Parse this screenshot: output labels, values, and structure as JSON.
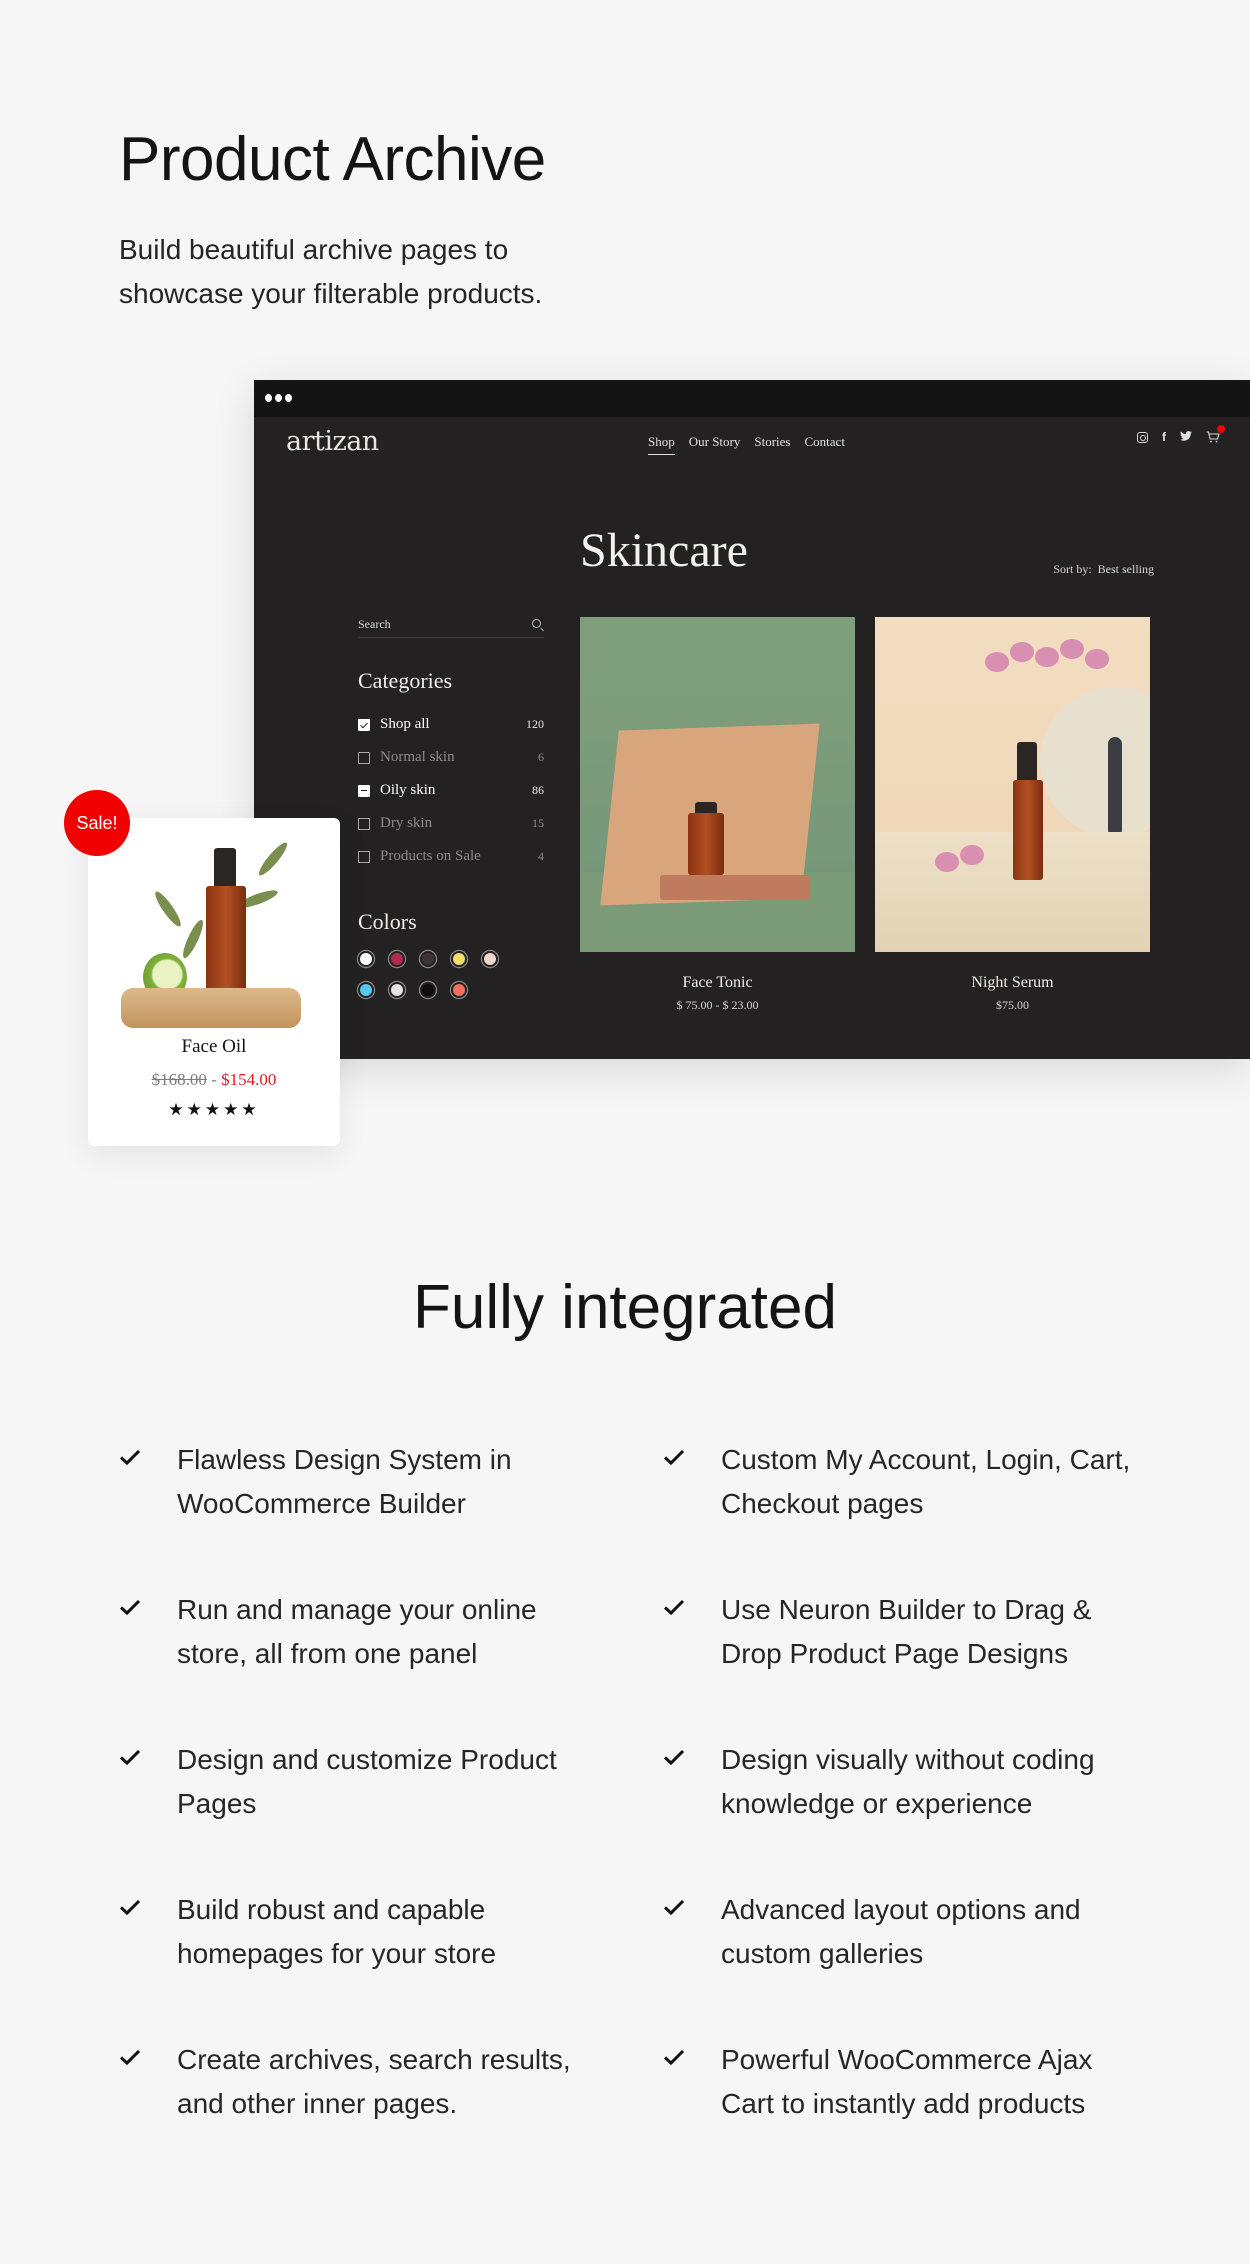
{
  "hero": {
    "title": "Product Archive",
    "subtitle": "Build beautiful archive pages to showcase your filterable products."
  },
  "browser": {
    "window_controls_icon": "more-dots-icon",
    "site": {
      "logo": "artizan",
      "menu": [
        {
          "label": "Shop",
          "active": true
        },
        {
          "label": "Our Story",
          "active": false
        },
        {
          "label": "Stories",
          "active": false
        },
        {
          "label": "Contact",
          "active": false
        }
      ],
      "social_icons": [
        "instagram-icon",
        "facebook-icon",
        "twitter-icon"
      ],
      "cart": {
        "icon": "cart-icon",
        "badge_count": "0",
        "badge_color": "#e00000"
      }
    },
    "page_title": "Skincare",
    "sort": {
      "label": "Sort by:",
      "value": "Best selling"
    },
    "sidebar": {
      "search_placeholder": "Search",
      "categories_title": "Categories",
      "categories": [
        {
          "label": "Shop all",
          "count": "120",
          "state": "checked"
        },
        {
          "label": "Normal skin",
          "count": "6",
          "state": "unchecked"
        },
        {
          "label": "Oily skin",
          "count": "86",
          "state": "partial"
        },
        {
          "label": "Dry skin",
          "count": "15",
          "state": "unchecked"
        },
        {
          "label": "Products on Sale",
          "count": "4",
          "state": "unchecked"
        }
      ],
      "colors_title": "Colors",
      "colors": [
        "#ffffff",
        "#b3294f",
        "#3d323a",
        "#f6dc6a",
        "#f2d6ca",
        "#5bc5f2",
        "#e4e4e6",
        "#0e0e0e",
        "#f0705a"
      ]
    },
    "products": [
      {
        "name": "Face Tonic",
        "price": "$ 75.00 - $ 23.00"
      },
      {
        "name": "Night Serum",
        "price": "$75.00"
      }
    ]
  },
  "sale_card": {
    "badge": "Sale!",
    "name": "Face Oil",
    "old_price": "$168.00",
    "separator": " - ",
    "new_price": "$154.00",
    "rating": 5,
    "stars": "★★★★★"
  },
  "features": {
    "title": "Fully integrated",
    "items": [
      "Flawless Design System in WooCommerce Builder",
      "Custom My Account, Login, Cart, Checkout pages",
      "Run and manage your online store, all from one panel",
      "Use Neuron Builder to Drag & Drop Product Page Designs",
      "Design and customize Product Pages",
      "Design visually without coding knowledge or experience",
      "Build robust and capable homepages for your store",
      "Advanced layout options and custom galleries",
      "Create archives, search results, and other inner pages.",
      "Powerful WooCommerce Ajax Cart to instantly add products"
    ]
  }
}
